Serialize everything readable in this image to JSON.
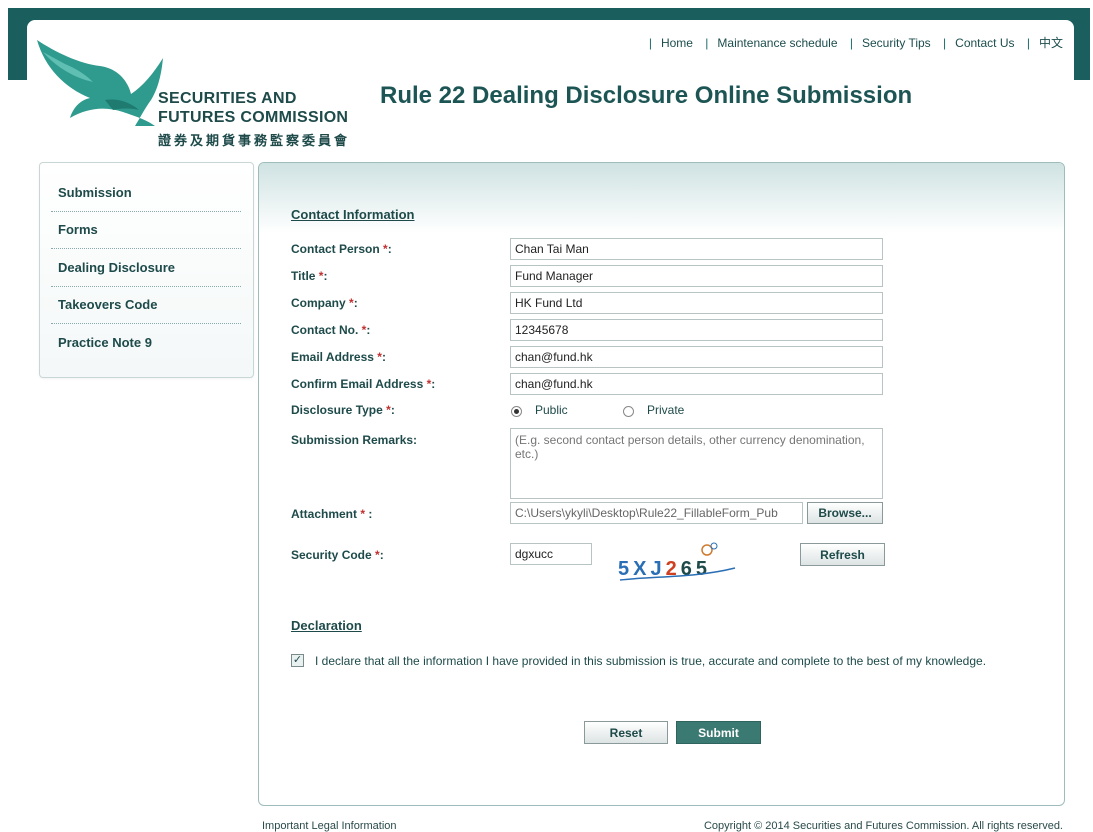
{
  "topnav": {
    "home": "Home",
    "maintenance": "Maintenance schedule",
    "security_tips": "Security Tips",
    "contact": "Contact Us",
    "chinese": "中文"
  },
  "logo": {
    "line1": "SECURITIES AND",
    "line2": "FUTURES COMMISSION",
    "zh": "證券及期貨事務監察委員會"
  },
  "page_title": "Rule 22 Dealing Disclosure Online Submission",
  "sidebar": {
    "items": [
      {
        "label": "Submission"
      },
      {
        "label": "Forms"
      },
      {
        "label": "Dealing Disclosure"
      },
      {
        "label": "Takeovers Code"
      },
      {
        "label": "Practice Note 9"
      }
    ]
  },
  "form": {
    "section_contact": "Contact Information",
    "required_mark": "*",
    "contact_person": {
      "label": "Contact Person ",
      "value": "Chan Tai Man"
    },
    "title": {
      "label": "Title ",
      "value": "Fund Manager"
    },
    "company": {
      "label": "Company ",
      "value": "HK Fund Ltd"
    },
    "contact_no": {
      "label": "Contact No. ",
      "value": "12345678"
    },
    "email": {
      "label": "Email Address ",
      "value": "chan@fund.hk"
    },
    "confirm_email": {
      "label": "Confirm Email Address ",
      "value": "chan@fund.hk"
    },
    "disclosure_type": {
      "label": "Disclosure Type ",
      "options": [
        "Public",
        "Private"
      ],
      "selected": "Public"
    },
    "remarks": {
      "label": "Submission Remarks:",
      "placeholder": "(E.g. second contact person details, other currency denomination, etc.)"
    },
    "attachment": {
      "label": "Attachment ",
      "value": "C:\\Users\\ykyli\\Desktop\\Rule22_FillableForm_Pub",
      "browse": "Browse..."
    },
    "security_code": {
      "label": "Security Code ",
      "value": "dgxucc",
      "captcha": "5XJ265",
      "refresh": "Refresh"
    },
    "colon": ":",
    "colon_spaced": " :"
  },
  "declaration": {
    "heading": "Declaration",
    "checked": true,
    "check_glyph": "✓",
    "text": "I declare that all the information I have provided in this submission is true, accurate and complete to the best of my knowledge."
  },
  "buttons": {
    "reset": "Reset",
    "submit": "Submit"
  },
  "footer": {
    "legal": "Important Legal Information",
    "copyright": "Copyright © 2014 Securities and Futures Commission. All rights reserved."
  },
  "colors": {
    "brand": "#1b5e5e",
    "accent": "#3b7a72",
    "required": "#c03030"
  }
}
